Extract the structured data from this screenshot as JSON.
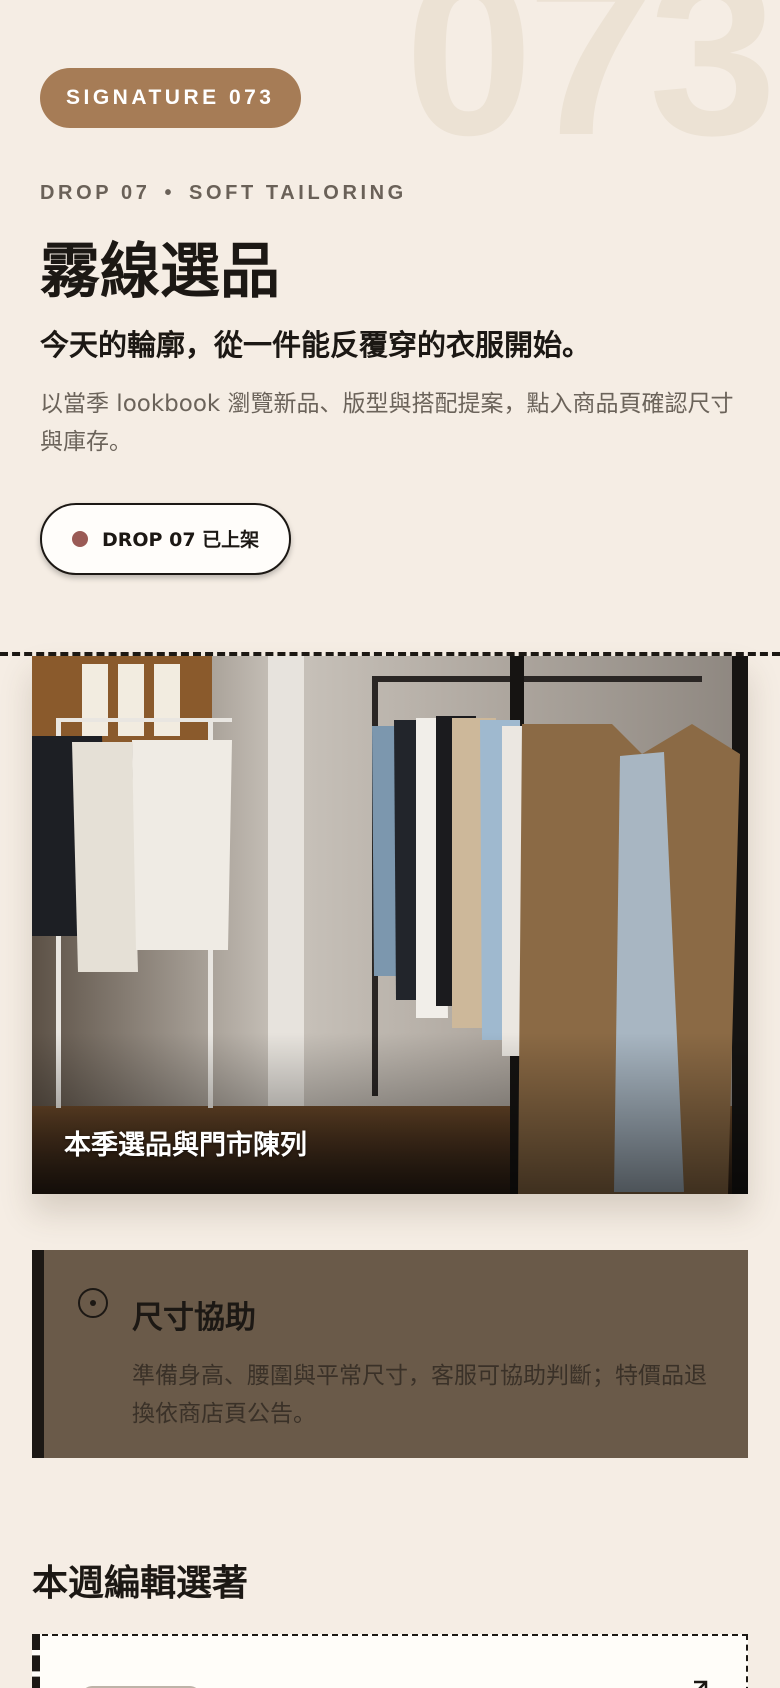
{
  "hero": {
    "watermark": "073",
    "badge": "SIGNATURE 073",
    "eyebrow_left": "DROP 07",
    "eyebrow_dot": "•",
    "eyebrow_right": "SOFT TAILORING",
    "title": "霧線選品",
    "subtitle": "今天的輪廓，從一件能反覆穿的衣服開始。",
    "description": "以當季 lookbook 瀏覽新品、版型與搭配提案，點入商品頁確認尺寸與庫存。",
    "drop_status": "DROP 07 已上架"
  },
  "feature_image": {
    "caption": "本季選品與門市陳列"
  },
  "size_help": {
    "title": "尺寸協助",
    "body": "準備身高、腰圍與平常尺寸，客服可協助判斷；特價品退換依商店頁公告。"
  },
  "editor_picks": {
    "title": "本週編輯選著"
  },
  "colors": {
    "background": "#f5ede4",
    "badge": "#a67c56",
    "ink": "#1c1814",
    "info_card": "#6a5a49",
    "status_dot": "#9a5a55"
  }
}
